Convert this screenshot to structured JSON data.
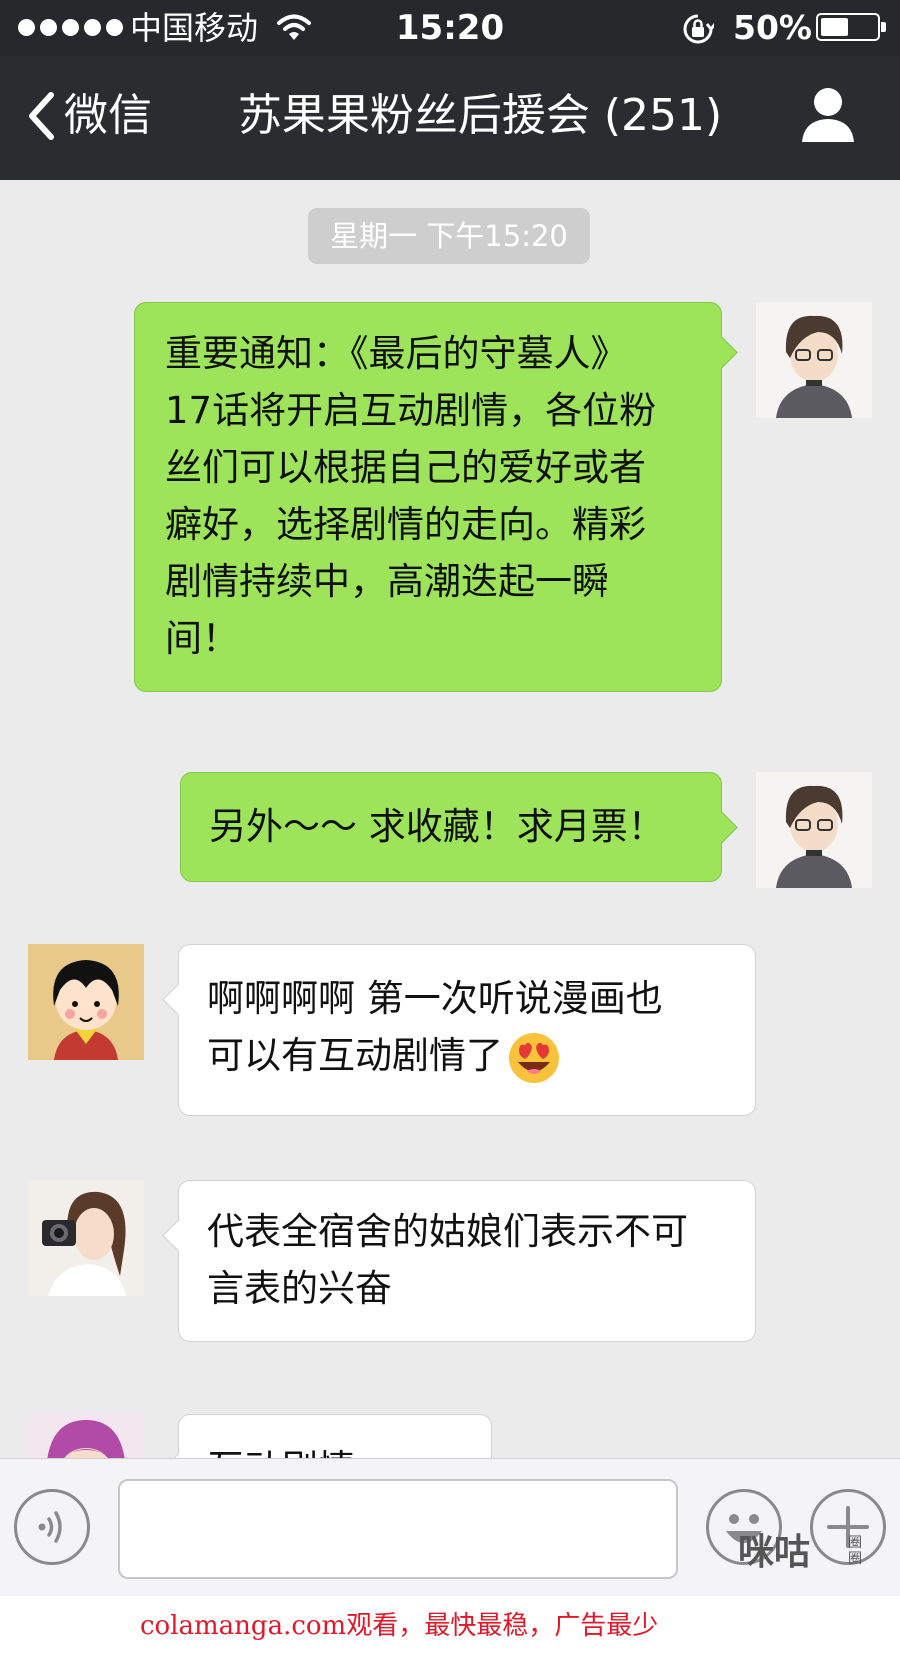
{
  "status_bar": {
    "carrier": "中国移动",
    "time": "15:20",
    "battery_percent": "50%",
    "battery_level": 0.5
  },
  "nav": {
    "back_label": "微信",
    "title": "苏果果粉丝后援会 (251)"
  },
  "chat": {
    "timestamp": "星期一 下午15:20",
    "messages": [
      {
        "direction": "outgoing",
        "lines": [
          "重要通知：《最后的守墓人》",
          "17话将开启互动剧情，各位粉",
          "丝们可以根据自己的爱好或者",
          "癖好，选择剧情的走向。精彩",
          "剧情持续中，高潮迭起一瞬",
          "间！"
        ]
      },
      {
        "direction": "outgoing",
        "lines": [
          "另外～～ 求收藏！求月票！"
        ]
      },
      {
        "direction": "incoming",
        "lines": [
          "啊啊啊啊 第一次听说漫画也",
          "可以有互动剧情了"
        ],
        "emoji": "heart-eyes-emoji"
      },
      {
        "direction": "incoming",
        "lines": [
          "代表全宿舍的姑娘们表示不可",
          "言表的兴奋"
        ]
      },
      {
        "direction": "incoming",
        "lines": [
          "互动剧情 QQQQ"
        ]
      }
    ]
  },
  "input_bar": {
    "voice_icon": "voice-icon",
    "emoji_icon": "smiley-icon",
    "plus_icon": "plus-icon",
    "watermark": "咪咕",
    "watermark_sub": "圈圈"
  },
  "footer": {
    "text": "colamanga.com观看，最快最稳，广告最少"
  },
  "colors": {
    "outgoing_bubble": "#9ee45b",
    "incoming_bubble": "#ffffff",
    "chat_background": "#ebebeb",
    "nav_background": "#2b2c30",
    "footer_text": "#e0182a"
  }
}
